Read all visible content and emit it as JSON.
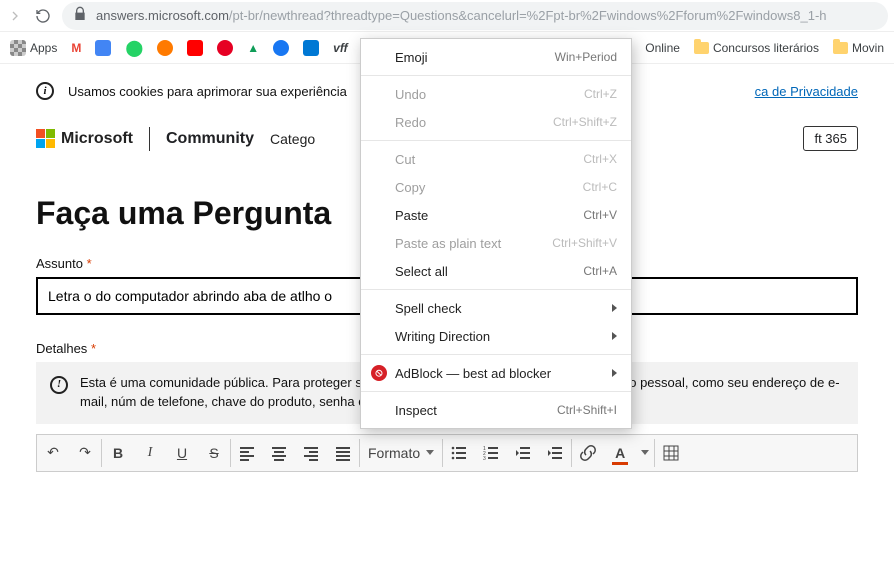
{
  "browser": {
    "url_host": "answers.microsoft.com",
    "url_path": "/pt-br/newthread?threadtype=Questions&cancelurl=%2Fpt-br%2Fwindows%2Fforum%2Fwindows8_1-h"
  },
  "bookmarks": {
    "apps": "Apps",
    "online": "Online",
    "concursos": "Concursos literários",
    "movin": "Movin"
  },
  "cookie": {
    "text_left": "Usamos cookies para aprimorar sua experiência",
    "link": "ca de Privacidade"
  },
  "header": {
    "ms": "Microsoft",
    "community": "Community",
    "catego": "Catego",
    "pill": "ft 365"
  },
  "page": {
    "title": "Faça uma Pergunta",
    "assunto_label": "Assunto",
    "assunto_value": "Letra o do computador abrindo aba de atlho o",
    "detalhes_label": "Detalhes",
    "warning": "Esta é uma comunidade pública. Para proteger sua privacidade, não poste nenhuma informação pessoal, como seu endereço de e-mail, núm de telefone, chave do produto, senha ou número de cartão de crédito."
  },
  "toolbar": {
    "format": "Formato"
  },
  "ctx": {
    "emoji": "Emoji",
    "emoji_sc": "Win+Period",
    "undo": "Undo",
    "undo_sc": "Ctrl+Z",
    "redo": "Redo",
    "redo_sc": "Ctrl+Shift+Z",
    "cut": "Cut",
    "cut_sc": "Ctrl+X",
    "copy": "Copy",
    "copy_sc": "Ctrl+C",
    "paste": "Paste",
    "paste_sc": "Ctrl+V",
    "pasteplain": "Paste as plain text",
    "pasteplain_sc": "Ctrl+Shift+V",
    "selectall": "Select all",
    "selectall_sc": "Ctrl+A",
    "spell": "Spell check",
    "writing": "Writing Direction",
    "adblock": "AdBlock — best ad blocker",
    "inspect": "Inspect",
    "inspect_sc": "Ctrl+Shift+I"
  }
}
